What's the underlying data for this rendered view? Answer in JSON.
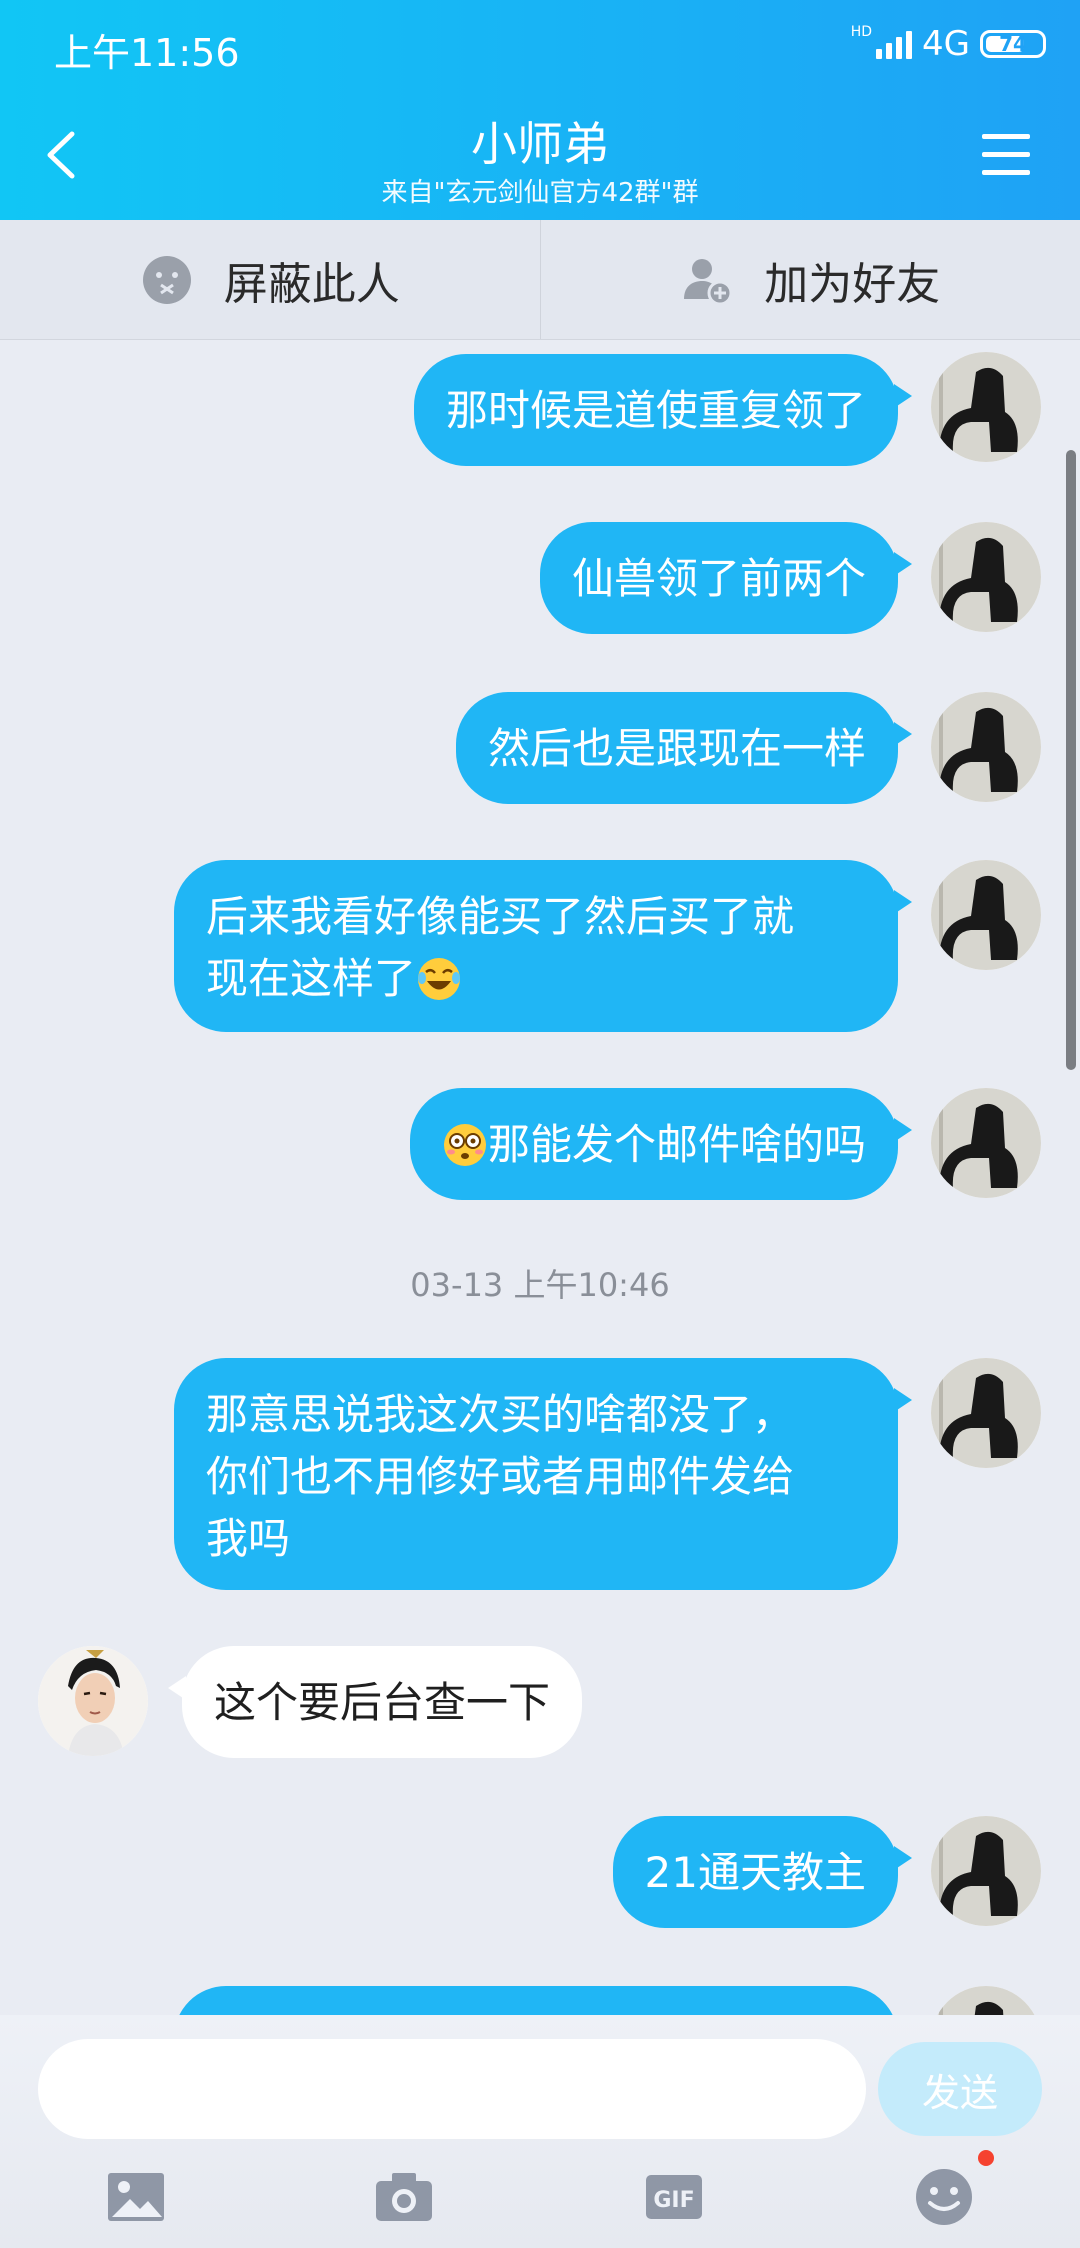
{
  "status": {
    "time": "上午11:56",
    "hd": "HD",
    "network": "4G",
    "battery": "74"
  },
  "header": {
    "title": "小师弟",
    "subtitle": "来自\"玄元剑仙官方42群\"群"
  },
  "actions": {
    "block": "屏蔽此人",
    "add_friend": "加为好友"
  },
  "messages": [
    {
      "side": "out",
      "text": "那时候是道使重复领了"
    },
    {
      "side": "out",
      "text": "仙兽领了前两个"
    },
    {
      "side": "out",
      "text": "然后也是跟现在一样"
    },
    {
      "side": "out",
      "line1": "后来我看好像能买了然后买了就",
      "line2": "现在这样了",
      "emoji": "laughing-tears"
    },
    {
      "side": "out",
      "text": "那能发个邮件啥的吗",
      "emoji_prefix": "flushed"
    },
    {
      "side": "out",
      "line1": "那意思说我这次买的啥都没了，",
      "line2": "你们也不用修好或者用邮件发给",
      "line3": "我吗"
    },
    {
      "side": "in",
      "text": "这个要后台查一下"
    },
    {
      "side": "out",
      "text": "21通天教主"
    }
  ],
  "timestamp": "03-13 上午10:46",
  "input": {
    "placeholder": "",
    "send_label": "发送"
  },
  "toolbar": {
    "icons": [
      "image-icon",
      "camera-icon",
      "gif-icon",
      "emoji-icon"
    ]
  },
  "colors": {
    "header_start": "#11c6f5",
    "header_end": "#1fa2f5",
    "bubble_out": "#20b6f5",
    "bubble_in": "#ffffff",
    "background": "#e9ecf3"
  }
}
